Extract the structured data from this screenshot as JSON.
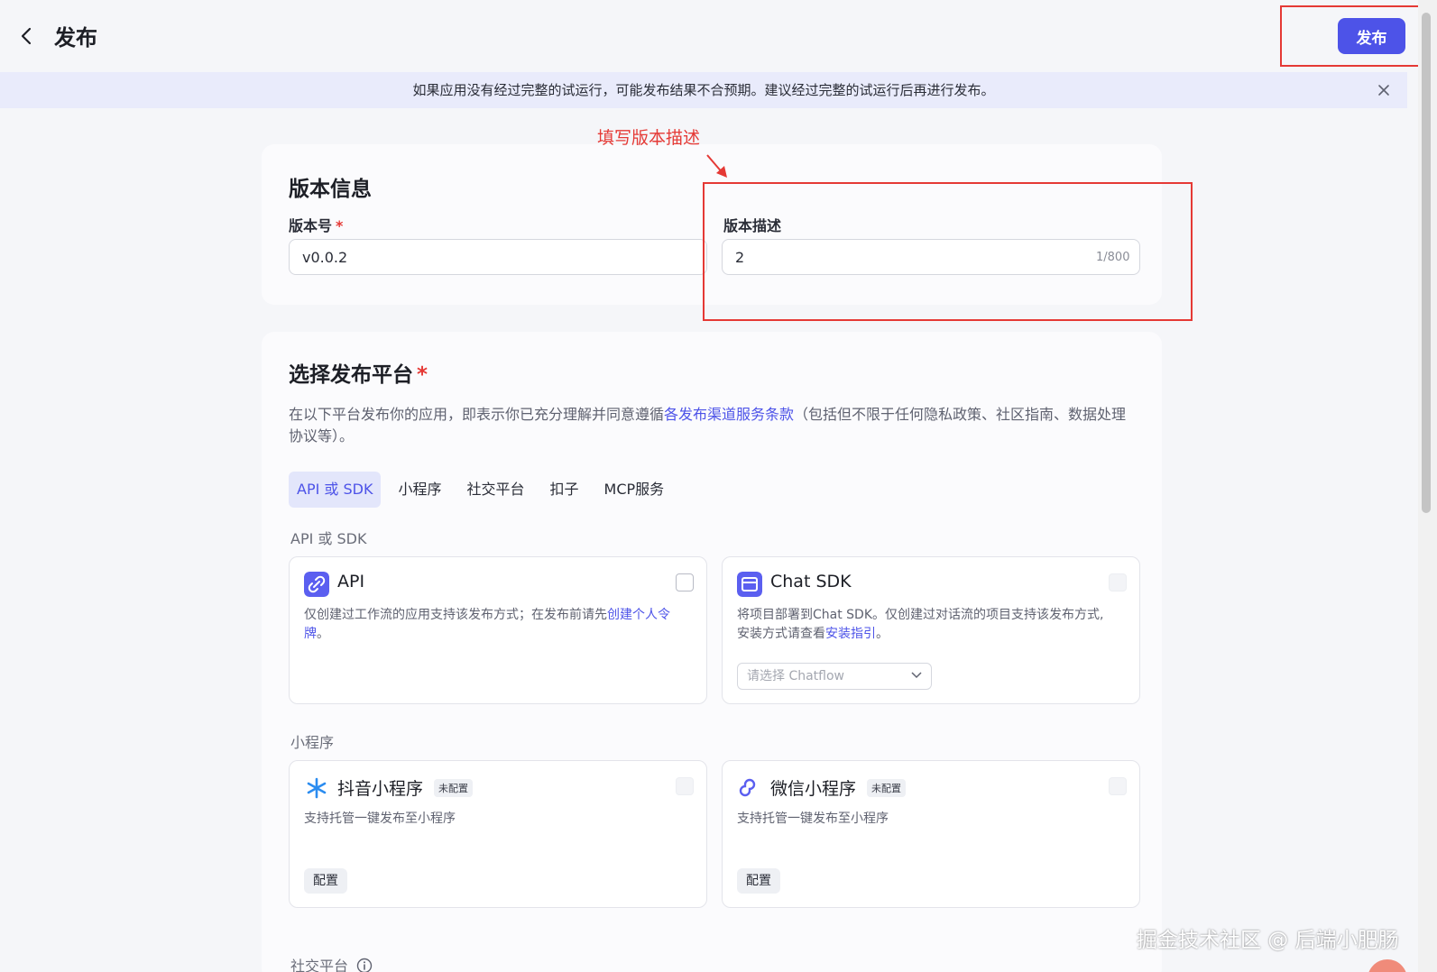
{
  "header": {
    "title": "发布",
    "publish_label": "发布"
  },
  "banner": {
    "text": "如果应用没有经过完整的试运行，可能发布结果不合预期。建议经过完整的试运行后再进行发布。"
  },
  "annotation": {
    "label": "填写版本描述",
    "color": "#e53935"
  },
  "version_info": {
    "title": "版本信息",
    "version_label": "版本号",
    "required_mark": "*",
    "version_value": "v0.0.2",
    "desc_label": "版本描述",
    "desc_value": "2",
    "desc_counter": "1/800"
  },
  "platform": {
    "title": "选择发布平台",
    "required_mark": "*",
    "desc_before": "在以下平台发布你的应用，即表示你已充分理解并同意遵循",
    "desc_link": "各发布渠道服务条款",
    "desc_after": "（包括但不限于任何隐私政策、社区指南、数据处理协议等）。",
    "tabs": [
      {
        "label": "API 或 SDK",
        "active": true
      },
      {
        "label": "小程序",
        "active": false
      },
      {
        "label": "社交平台",
        "active": false
      },
      {
        "label": "扣子",
        "active": false
      },
      {
        "label": "MCP服务",
        "active": false
      }
    ],
    "groups": {
      "api_sdk": {
        "label": "API 或 SDK",
        "api": {
          "title": "API",
          "desc": "仅创建过工作流的应用支持该发布方式；在发布前请先",
          "link": "创建个人令牌",
          "desc_end": "。"
        },
        "chat_sdk": {
          "title": "Chat SDK",
          "desc": "将项目部署到Chat SDK。仅创建过对话流的项目支持该发布方式,安装方式请查看",
          "link": "安装指引",
          "desc_end": "。",
          "select_placeholder": "请选择 Chatflow"
        }
      },
      "mini_program": {
        "label": "小程序",
        "douyin": {
          "title": "抖音小程序",
          "badge": "未配置",
          "desc": "支持托管一键发布至小程序",
          "config_label": "配置"
        },
        "wechat": {
          "title": "微信小程序",
          "badge": "未配置",
          "desc": "支持托管一键发布至小程序",
          "config_label": "配置"
        }
      },
      "social": {
        "label": "社交平台"
      }
    }
  },
  "watermark": "掘金技术社区 @ 后端小肥肠",
  "colors": {
    "accent": "#4d53e8",
    "banner_bg": "#e9ebfb"
  }
}
